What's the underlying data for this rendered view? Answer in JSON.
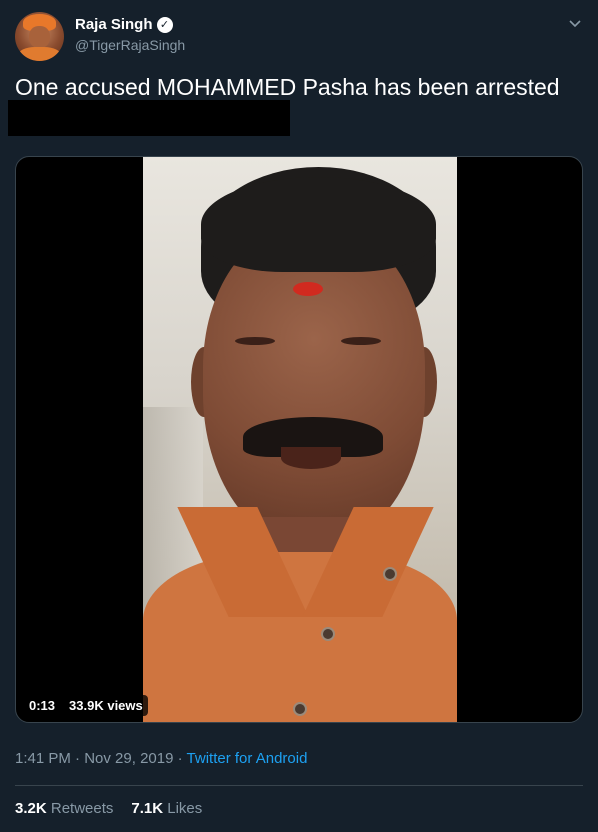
{
  "author": {
    "display_name": "Raja Singh",
    "handle": "@TigerRajaSingh",
    "verified_icon": "verified-badge-icon"
  },
  "tweet": {
    "text": "One accused MOHAMMED Pasha has been arrested"
  },
  "video": {
    "duration": "0:13",
    "views": "33.9K views"
  },
  "meta": {
    "time": "1:41 PM",
    "separator": "·",
    "date": "Nov 29, 2019",
    "source": "Twitter for Android"
  },
  "stats": {
    "retweets_count": "3.2K",
    "retweets_label": "Retweets",
    "likes_count": "7.1K",
    "likes_label": "Likes"
  },
  "colors": {
    "background": "#15202b",
    "muted": "#8899a6",
    "link": "#1da1f2",
    "border": "#38444d"
  }
}
